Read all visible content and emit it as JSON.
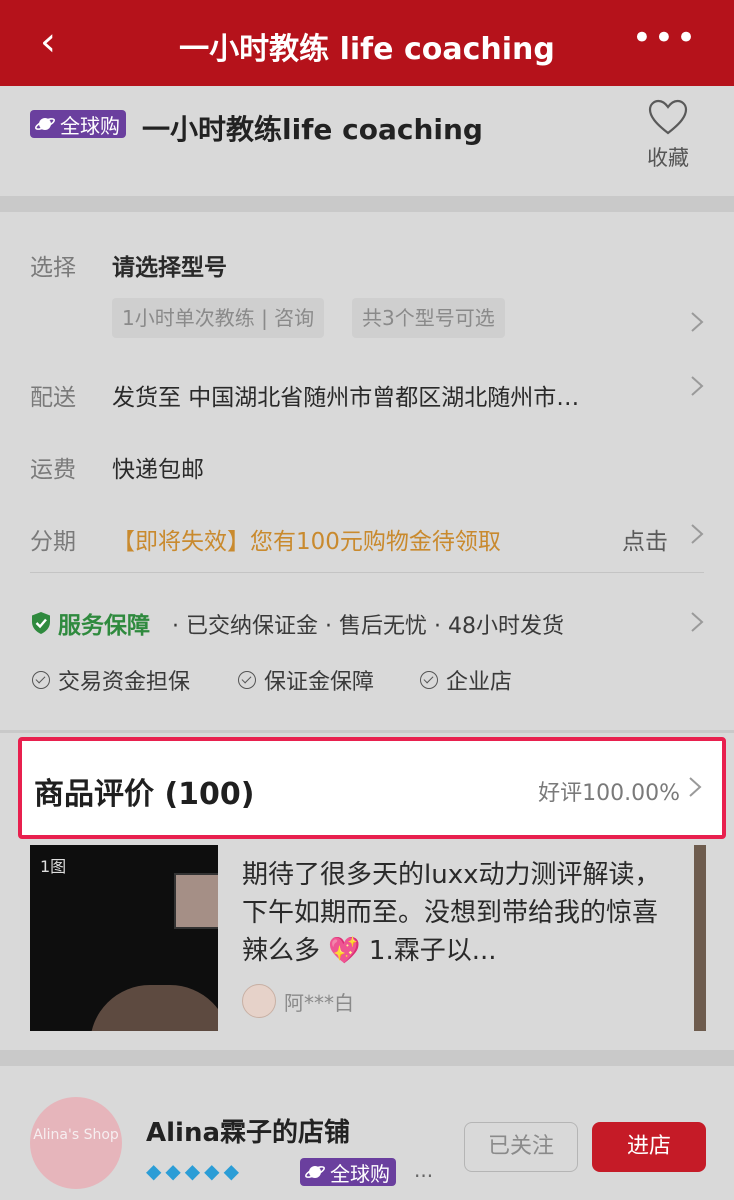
{
  "header": {
    "back_icon": "chevron-left-icon",
    "title": "一小时教练 life coaching",
    "more_icon": "more-dots-icon",
    "bg_color": "#b5121b"
  },
  "product": {
    "badge": "全球购",
    "name": "一小时教练life coaching",
    "favorite_label": "收藏",
    "favorite_icon": "heart-icon"
  },
  "options": {
    "select": {
      "label": "选择",
      "value": "请选择型号",
      "chip_1": "1小时单次教练 | 咨询",
      "chip_2": "共3个型号可选"
    },
    "delivery": {
      "label": "配送",
      "value": "发货至  中国湖北省随州市曾都区湖北随州市…"
    },
    "shipping": {
      "label": "运费",
      "value": "快递包邮"
    },
    "installment": {
      "label": "分期",
      "value": "【即将失效】您有100元购物金待领取",
      "action": "点击",
      "accent_color": "#c98a2e"
    },
    "service": {
      "title": "服务保障",
      "items": "· 已交纳保证金 · 售后无忧 · 48小时发货",
      "accent_color": "#2f8a3e"
    },
    "guarantees": [
      "交易资金担保",
      "保证金保障",
      "企业店"
    ]
  },
  "reviews": {
    "title": "商品评价 (100)",
    "rate": "好评100.00%",
    "highlight_color": "#e8204e",
    "item": {
      "image_count": "1图",
      "text": "期待了很多天的luxx动力测评解读，下午如期而至。没想到带给我的惊喜辣么多 💖 1.霖子以...",
      "user": "阿***白"
    }
  },
  "shop": {
    "logo_text": "Alina's Shop",
    "name": "Alina霖子的店铺",
    "badge": "全球购",
    "more": "...",
    "follow_label": "已关注",
    "enter_label": "进店"
  }
}
